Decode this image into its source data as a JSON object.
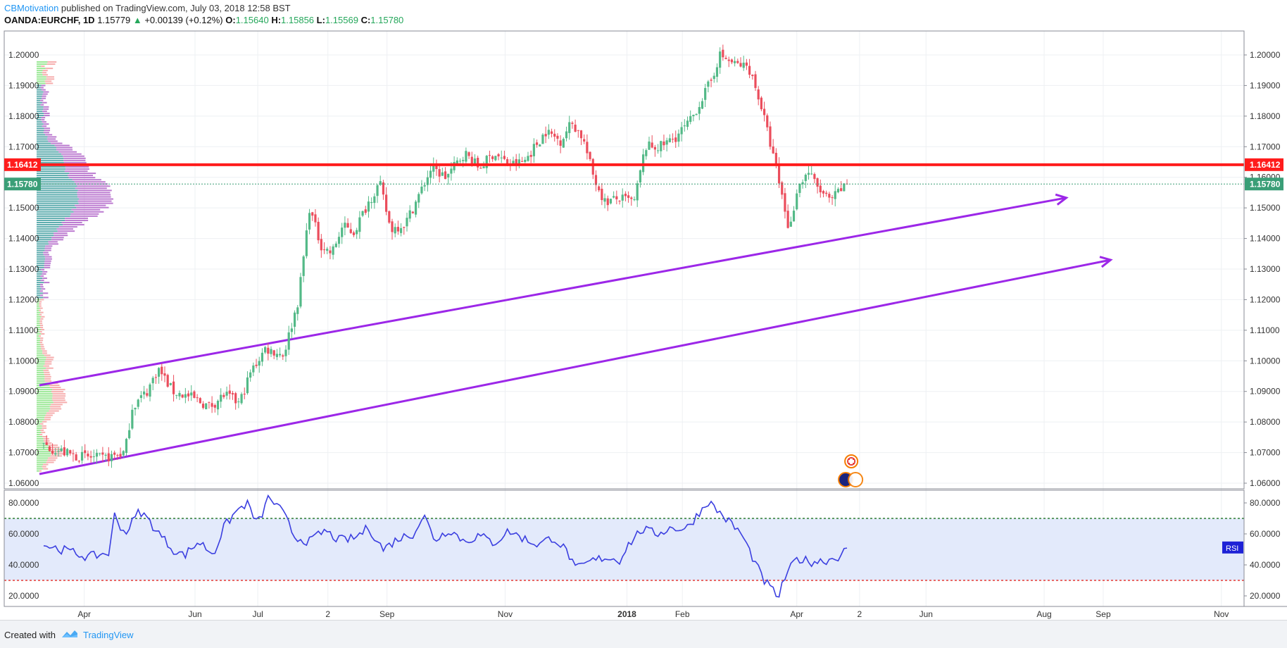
{
  "header": {
    "user": "CBMotivation",
    "published": " published on TradingView.com, July 03, 2018 12:58 BST",
    "symbol": "OANDA:EURCHF, 1D",
    "last": "1.15779",
    "arrow": "▲",
    "change": "+0.00139 (+0.12%)",
    "o_label": "O:",
    "o_value": "1.15640",
    "h_label": "H:",
    "h_value": "1.15856",
    "l_label": "L:",
    "l_value": "1.15569",
    "c_label": "C:",
    "c_value": "1.15780"
  },
  "footer": {
    "created": "Created with",
    "brand": "TradingView"
  },
  "colors": {
    "up": "#53b987",
    "down": "#eb4d5c",
    "support": "#9c27e8",
    "resistance": "#ff1c1c",
    "rsi_line": "#3b3fe0",
    "rsi_fill": "#e3eafb",
    "price_label": "#3a9e77"
  },
  "chart_data": [
    {
      "type": "candlestick",
      "symbol": "OANDA:EURCHF",
      "interval": "1D",
      "x_ticks": [
        "Apr",
        "Jun",
        "Jul",
        "2",
        "Sep",
        "Nov",
        "2018",
        "Feb",
        "Apr",
        "2",
        "Jun",
        "Aug",
        "Sep",
        "Nov"
      ],
      "y_ticks": [
        "1.20000",
        "1.19000",
        "1.18000",
        "1.17000",
        "1.16000",
        "1.15000",
        "1.14000",
        "1.13000",
        "1.12000",
        "1.11000",
        "1.10000",
        "1.09000",
        "1.08000",
        "1.07000",
        "1.06000"
      ],
      "ylim": [
        1.058,
        1.208
      ],
      "close_path": [
        [
          0,
          1.0725
        ],
        [
          40,
          1.069
        ],
        [
          80,
          1.068
        ],
        [
          110,
          1.07
        ],
        [
          120,
          1.085
        ],
        [
          140,
          1.09
        ],
        [
          155,
          1.0975
        ],
        [
          175,
          1.09
        ],
        [
          200,
          1.088
        ],
        [
          225,
          1.085
        ],
        [
          245,
          1.089
        ],
        [
          265,
          1.086
        ],
        [
          280,
          1.096
        ],
        [
          300,
          1.104
        ],
        [
          325,
          1.102
        ],
        [
          345,
          1.12
        ],
        [
          360,
          1.15
        ],
        [
          375,
          1.138
        ],
        [
          390,
          1.135
        ],
        [
          405,
          1.144
        ],
        [
          420,
          1.142
        ],
        [
          440,
          1.152
        ],
        [
          455,
          1.158
        ],
        [
          470,
          1.143
        ],
        [
          490,
          1.145
        ],
        [
          510,
          1.155
        ],
        [
          525,
          1.163
        ],
        [
          545,
          1.16
        ],
        [
          570,
          1.168
        ],
        [
          590,
          1.163
        ],
        [
          610,
          1.168
        ],
        [
          630,
          1.164
        ],
        [
          650,
          1.165
        ],
        [
          665,
          1.17
        ],
        [
          680,
          1.175
        ],
        [
          700,
          1.172
        ],
        [
          715,
          1.178
        ],
        [
          730,
          1.173
        ],
        [
          745,
          1.16
        ],
        [
          760,
          1.152
        ],
        [
          780,
          1.153
        ],
        [
          800,
          1.152
        ],
        [
          815,
          1.17
        ],
        [
          835,
          1.17
        ],
        [
          855,
          1.173
        ],
        [
          875,
          1.178
        ],
        [
          890,
          1.185
        ],
        [
          905,
          1.192
        ],
        [
          915,
          1.2
        ],
        [
          935,
          1.197
        ],
        [
          955,
          1.196
        ],
        [
          970,
          1.185
        ],
        [
          985,
          1.17
        ],
        [
          1000,
          1.154
        ],
        [
          1010,
          1.142
        ],
        [
          1020,
          1.156
        ],
        [
          1035,
          1.162
        ],
        [
          1050,
          1.156
        ],
        [
          1065,
          1.152
        ],
        [
          1080,
          1.156
        ],
        [
          1090,
          1.1578
        ]
      ],
      "last_date_index": 1090,
      "hlines": [
        {
          "value": 1.16412,
          "label": "1.16412",
          "style": "solid"
        },
        {
          "value": 1.1578,
          "label": "1.15780",
          "style": "dotted"
        }
      ],
      "trendlines": [
        {
          "from": [
            0,
            1.092
          ],
          "to": [
            1385,
            1.1533
          ]
        },
        {
          "from": [
            0,
            1.063
          ],
          "to": [
            1445,
            1.133
          ]
        }
      ],
      "volume_profile_range": [
        1.064,
        1.198
      ]
    },
    {
      "type": "line",
      "series": [
        {
          "name": "RSI"
        }
      ],
      "badge": "RSI",
      "y_ticks": [
        "80.0000",
        "60.0000",
        "40.0000",
        "20.0000"
      ],
      "ylim": [
        16,
        86
      ],
      "levels": [
        70,
        30
      ],
      "path": [
        [
          0,
          53
        ],
        [
          40,
          48
        ],
        [
          60,
          45
        ],
        [
          90,
          48
        ],
        [
          95,
          73
        ],
        [
          110,
          60
        ],
        [
          130,
          75
        ],
        [
          140,
          70
        ],
        [
          160,
          58
        ],
        [
          175,
          50
        ],
        [
          190,
          46
        ],
        [
          210,
          55
        ],
        [
          230,
          47
        ],
        [
          245,
          65
        ],
        [
          260,
          74
        ],
        [
          275,
          80
        ],
        [
          290,
          66
        ],
        [
          305,
          84
        ],
        [
          325,
          73
        ],
        [
          340,
          58
        ],
        [
          360,
          55
        ],
        [
          380,
          62
        ],
        [
          400,
          56
        ],
        [
          420,
          57
        ],
        [
          440,
          64
        ],
        [
          460,
          50
        ],
        [
          480,
          57
        ],
        [
          500,
          60
        ],
        [
          515,
          72
        ],
        [
          530,
          56
        ],
        [
          550,
          63
        ],
        [
          570,
          55
        ],
        [
          590,
          59
        ],
        [
          610,
          54
        ],
        [
          630,
          62
        ],
        [
          650,
          57
        ],
        [
          670,
          53
        ],
        [
          690,
          58
        ],
        [
          710,
          48
        ],
        [
          720,
          37
        ],
        [
          740,
          42
        ],
        [
          760,
          45
        ],
        [
          780,
          43
        ],
        [
          790,
          52
        ],
        [
          810,
          63
        ],
        [
          830,
          60
        ],
        [
          850,
          64
        ],
        [
          870,
          63
        ],
        [
          885,
          72
        ],
        [
          900,
          81
        ],
        [
          915,
          74
        ],
        [
          930,
          67
        ],
        [
          945,
          60
        ],
        [
          960,
          45
        ],
        [
          975,
          30
        ],
        [
          985,
          25
        ],
        [
          995,
          19
        ],
        [
          1005,
          33
        ],
        [
          1020,
          44
        ],
        [
          1040,
          42
        ],
        [
          1060,
          43
        ],
        [
          1075,
          45
        ],
        [
          1085,
          49
        ]
      ]
    }
  ]
}
